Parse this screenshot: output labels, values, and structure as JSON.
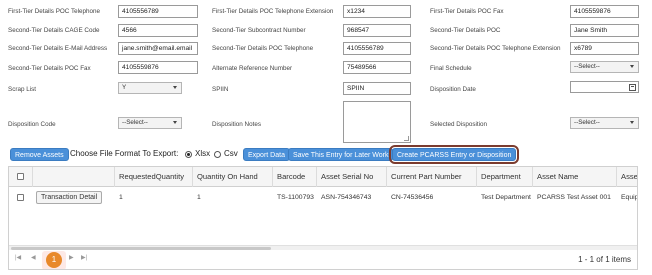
{
  "form": {
    "row1": {
      "poc_phone_label": "First-Tier Details POC Telephone",
      "poc_phone_value": "4105556789",
      "poc_phone_ext_label": "First-Tier Details POC Telephone Extension",
      "poc_phone_ext_value": "x1234",
      "poc_fax_label": "First-Tier Details POC Fax",
      "poc_fax_value": "4105559876"
    },
    "row2": {
      "cage_label": "Second-Tier Details CAGE Code",
      "cage_value": "4566",
      "subcontract_label": "Second-Tier Subcontract Number",
      "subcontract_value": "968547",
      "poc_label": "Second-Tier Details POC",
      "poc_value": "Jane Smith"
    },
    "row3": {
      "email_label": "Second-Tier Details E-Mail Address",
      "email_value": "jane.smith@email.email",
      "poc_phone_label": "Second-Tier Details POC Telephone",
      "poc_phone_value": "4105556789",
      "poc_phone_ext_label": "Second-Tier Details POC Telephone Extension",
      "poc_phone_ext_value": "x6789"
    },
    "row4": {
      "poc_fax_label": "Second-Tier Details POC Fax",
      "poc_fax_value": "4105559876",
      "alt_ref_label": "Alternate Reference Number",
      "alt_ref_value": "75489566",
      "final_schedule_label": "Final Schedule",
      "final_schedule_value": "--Select--"
    },
    "row5": {
      "scrap_label": "Scrap List",
      "scrap_value": "Y",
      "spiin_label": "SPIIN",
      "spiin_value": "SPIIN",
      "disposition_date_label": "Disposition Date",
      "disposition_date_value": ""
    },
    "row6": {
      "disposition_code_label": "Disposition Code",
      "disposition_code_value": "--Select--",
      "disposition_notes_label": "Disposition Notes",
      "disposition_notes_value": "",
      "selected_disposition_label": "Selected Disposition",
      "selected_disposition_value": "--Select--"
    }
  },
  "toolbar": {
    "remove_assets": "Remove Assets",
    "file_format_label": "Choose File Format To Export:",
    "xlsx_label": "Xlsx",
    "csv_label": "Csv",
    "selected_format": "Xlsx",
    "export_data": "Export Data",
    "save_entry": "Save This Entry for Later Work",
    "create_entry": "Create PCARSS Entry or Disposition"
  },
  "grid": {
    "columns": [
      "",
      "RequestedQuantity",
      "Quantity On Hand",
      "Barcode",
      "Asset Serial No",
      "Current Part Number",
      "Department",
      "Asset Name",
      "Asse"
    ],
    "rows": [
      {
        "action": "Transaction Detail",
        "requested_quantity": "1",
        "quantity_on_hand": "1",
        "barcode": "TS-1100793",
        "asset_serial_no": "ASN-754346743",
        "current_part_number": "CN-74536456",
        "department": "Test Department",
        "asset_name": "PCARSS Test Asset 001",
        "asset_extra": "Equip"
      }
    ]
  },
  "pager": {
    "current_page": "1",
    "info": "1 - 1 of 1 items"
  },
  "colors": {
    "button_blue": "#4a90d9",
    "highlight_border": "#7b3b2e",
    "page_badge": "#e8892b"
  }
}
